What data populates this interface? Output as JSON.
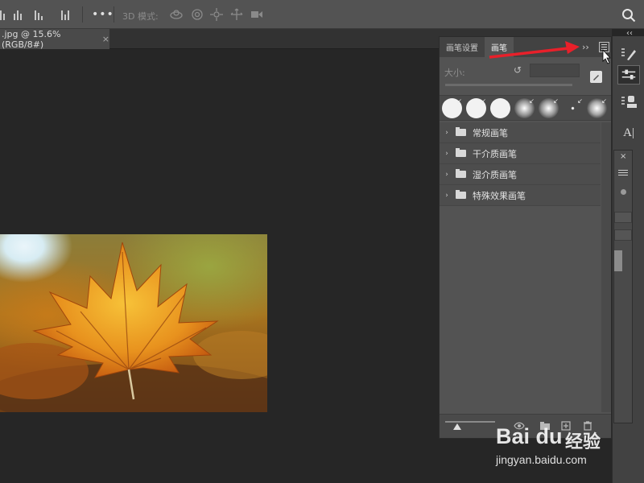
{
  "options_bar": {
    "mode_3d_label": "3D 模式:",
    "more_glyph": "•••"
  },
  "document_tab": {
    "title": ".jpg @ 15.6%(RGB/8#)",
    "close_glyph": "×"
  },
  "top_collapse_glyph": "‹‹",
  "brush_panel": {
    "tabs": [
      {
        "label": "画笔设置",
        "active": false
      },
      {
        "label": "画笔",
        "active": true
      }
    ],
    "expand_glyph": "››",
    "size_label": "大小:",
    "reset_glyph": "↺",
    "size_value": "",
    "preset_marker": "↙",
    "groups": [
      {
        "label": "常规画笔"
      },
      {
        "label": "干介质画笔"
      },
      {
        "label": "湿介质画笔"
      },
      {
        "label": "特殊效果画笔"
      }
    ]
  },
  "right_toolbar": {
    "char_label": "A|"
  },
  "watermark": {
    "logo": "Bai du",
    "brand_cn": "经验",
    "url": "jingyan.baidu.com"
  },
  "colors": {
    "annotation_arrow": "#e8202a",
    "panel_bg": "#535353",
    "workspace_bg": "#262626"
  }
}
